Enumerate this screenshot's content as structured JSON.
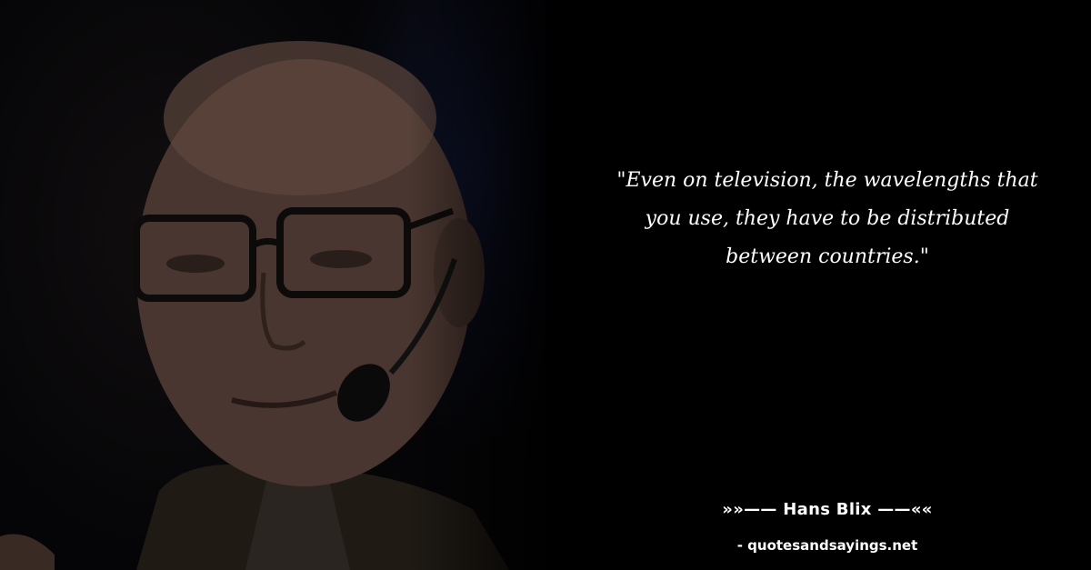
{
  "quote": {
    "text": "\"Even on television, the wavelengths that you use, they have to be distributed between countries.\""
  },
  "author": {
    "line": "»»—— Hans Blix ——««"
  },
  "source": {
    "text": "- quotesandsayings.net"
  },
  "photo": {
    "subject": "portrait-photo",
    "colors": {
      "background": "#000000",
      "skin": "#5a4238",
      "stage_light": "#141c46"
    }
  }
}
